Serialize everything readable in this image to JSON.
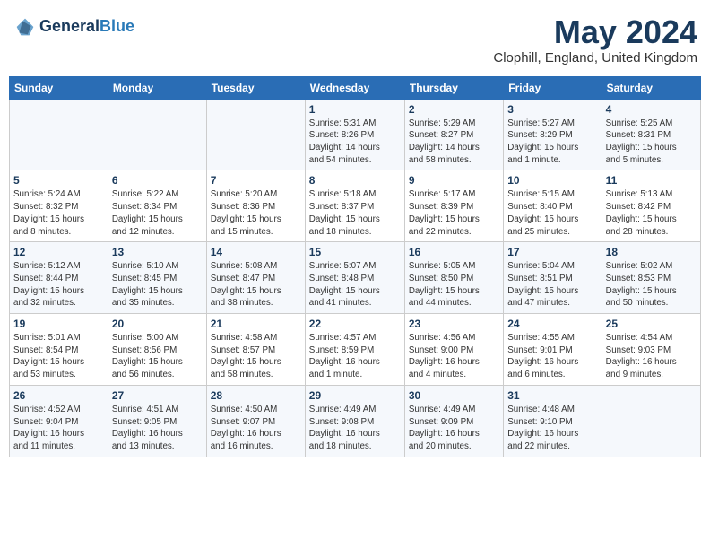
{
  "header": {
    "logo_line1": "General",
    "logo_line2": "Blue",
    "month": "May 2024",
    "location": "Clophill, England, United Kingdom"
  },
  "weekdays": [
    "Sunday",
    "Monday",
    "Tuesday",
    "Wednesday",
    "Thursday",
    "Friday",
    "Saturday"
  ],
  "weeks": [
    [
      {
        "day": "",
        "info": ""
      },
      {
        "day": "",
        "info": ""
      },
      {
        "day": "",
        "info": ""
      },
      {
        "day": "1",
        "info": "Sunrise: 5:31 AM\nSunset: 8:26 PM\nDaylight: 14 hours\nand 54 minutes."
      },
      {
        "day": "2",
        "info": "Sunrise: 5:29 AM\nSunset: 8:27 PM\nDaylight: 14 hours\nand 58 minutes."
      },
      {
        "day": "3",
        "info": "Sunrise: 5:27 AM\nSunset: 8:29 PM\nDaylight: 15 hours\nand 1 minute."
      },
      {
        "day": "4",
        "info": "Sunrise: 5:25 AM\nSunset: 8:31 PM\nDaylight: 15 hours\nand 5 minutes."
      }
    ],
    [
      {
        "day": "5",
        "info": "Sunrise: 5:24 AM\nSunset: 8:32 PM\nDaylight: 15 hours\nand 8 minutes."
      },
      {
        "day": "6",
        "info": "Sunrise: 5:22 AM\nSunset: 8:34 PM\nDaylight: 15 hours\nand 12 minutes."
      },
      {
        "day": "7",
        "info": "Sunrise: 5:20 AM\nSunset: 8:36 PM\nDaylight: 15 hours\nand 15 minutes."
      },
      {
        "day": "8",
        "info": "Sunrise: 5:18 AM\nSunset: 8:37 PM\nDaylight: 15 hours\nand 18 minutes."
      },
      {
        "day": "9",
        "info": "Sunrise: 5:17 AM\nSunset: 8:39 PM\nDaylight: 15 hours\nand 22 minutes."
      },
      {
        "day": "10",
        "info": "Sunrise: 5:15 AM\nSunset: 8:40 PM\nDaylight: 15 hours\nand 25 minutes."
      },
      {
        "day": "11",
        "info": "Sunrise: 5:13 AM\nSunset: 8:42 PM\nDaylight: 15 hours\nand 28 minutes."
      }
    ],
    [
      {
        "day": "12",
        "info": "Sunrise: 5:12 AM\nSunset: 8:44 PM\nDaylight: 15 hours\nand 32 minutes."
      },
      {
        "day": "13",
        "info": "Sunrise: 5:10 AM\nSunset: 8:45 PM\nDaylight: 15 hours\nand 35 minutes."
      },
      {
        "day": "14",
        "info": "Sunrise: 5:08 AM\nSunset: 8:47 PM\nDaylight: 15 hours\nand 38 minutes."
      },
      {
        "day": "15",
        "info": "Sunrise: 5:07 AM\nSunset: 8:48 PM\nDaylight: 15 hours\nand 41 minutes."
      },
      {
        "day": "16",
        "info": "Sunrise: 5:05 AM\nSunset: 8:50 PM\nDaylight: 15 hours\nand 44 minutes."
      },
      {
        "day": "17",
        "info": "Sunrise: 5:04 AM\nSunset: 8:51 PM\nDaylight: 15 hours\nand 47 minutes."
      },
      {
        "day": "18",
        "info": "Sunrise: 5:02 AM\nSunset: 8:53 PM\nDaylight: 15 hours\nand 50 minutes."
      }
    ],
    [
      {
        "day": "19",
        "info": "Sunrise: 5:01 AM\nSunset: 8:54 PM\nDaylight: 15 hours\nand 53 minutes."
      },
      {
        "day": "20",
        "info": "Sunrise: 5:00 AM\nSunset: 8:56 PM\nDaylight: 15 hours\nand 56 minutes."
      },
      {
        "day": "21",
        "info": "Sunrise: 4:58 AM\nSunset: 8:57 PM\nDaylight: 15 hours\nand 58 minutes."
      },
      {
        "day": "22",
        "info": "Sunrise: 4:57 AM\nSunset: 8:59 PM\nDaylight: 16 hours\nand 1 minute."
      },
      {
        "day": "23",
        "info": "Sunrise: 4:56 AM\nSunset: 9:00 PM\nDaylight: 16 hours\nand 4 minutes."
      },
      {
        "day": "24",
        "info": "Sunrise: 4:55 AM\nSunset: 9:01 PM\nDaylight: 16 hours\nand 6 minutes."
      },
      {
        "day": "25",
        "info": "Sunrise: 4:54 AM\nSunset: 9:03 PM\nDaylight: 16 hours\nand 9 minutes."
      }
    ],
    [
      {
        "day": "26",
        "info": "Sunrise: 4:52 AM\nSunset: 9:04 PM\nDaylight: 16 hours\nand 11 minutes."
      },
      {
        "day": "27",
        "info": "Sunrise: 4:51 AM\nSunset: 9:05 PM\nDaylight: 16 hours\nand 13 minutes."
      },
      {
        "day": "28",
        "info": "Sunrise: 4:50 AM\nSunset: 9:07 PM\nDaylight: 16 hours\nand 16 minutes."
      },
      {
        "day": "29",
        "info": "Sunrise: 4:49 AM\nSunset: 9:08 PM\nDaylight: 16 hours\nand 18 minutes."
      },
      {
        "day": "30",
        "info": "Sunrise: 4:49 AM\nSunset: 9:09 PM\nDaylight: 16 hours\nand 20 minutes."
      },
      {
        "day": "31",
        "info": "Sunrise: 4:48 AM\nSunset: 9:10 PM\nDaylight: 16 hours\nand 22 minutes."
      },
      {
        "day": "",
        "info": ""
      }
    ]
  ]
}
